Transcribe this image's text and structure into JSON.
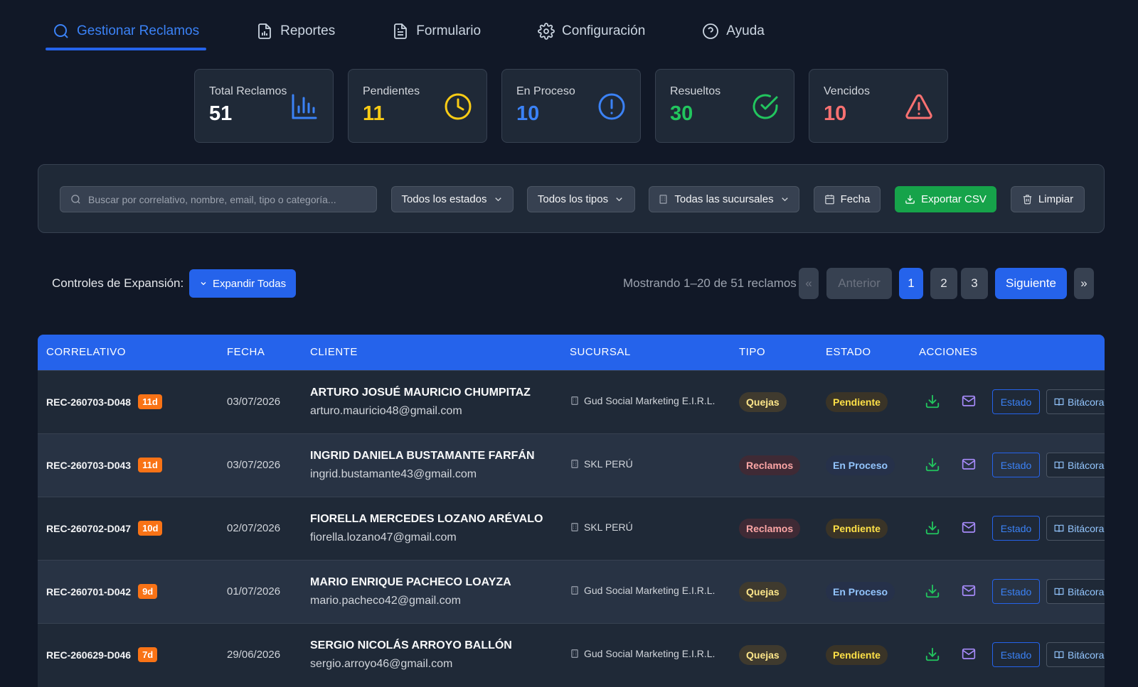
{
  "tabs": [
    {
      "label": "Gestionar Reclamos",
      "icon": "search-icon"
    },
    {
      "label": "Reportes",
      "icon": "report-icon"
    },
    {
      "label": "Formulario",
      "icon": "document-icon"
    },
    {
      "label": "Configuración",
      "icon": "gear-icon"
    },
    {
      "label": "Ayuda",
      "icon": "help-icon"
    }
  ],
  "stats": [
    {
      "label": "Total Reclamos",
      "value": "51",
      "color": "#ffffff",
      "icon_color": "#3b82f6",
      "icon": "bar-chart-icon"
    },
    {
      "label": "Pendientes",
      "value": "11",
      "color": "#facc15",
      "icon_color": "#facc15",
      "icon": "clock-icon"
    },
    {
      "label": "En Proceso",
      "value": "10",
      "color": "#3b82f6",
      "icon_color": "#3b82f6",
      "icon": "alert-circle-icon"
    },
    {
      "label": "Resueltos",
      "value": "30",
      "color": "#22c55e",
      "icon_color": "#22c55e",
      "icon": "check-circle-icon"
    },
    {
      "label": "Vencidos",
      "value": "10",
      "color": "#f87171",
      "icon_color": "#f87171",
      "icon": "warning-icon"
    }
  ],
  "filters": {
    "search_placeholder": "Buscar por correlativo, nombre, email, tipo o categoría...",
    "status": "Todos los estados",
    "type": "Todos los tipos",
    "branch": "Todas las sucursales",
    "date": "Fecha",
    "export": "Exportar CSV",
    "clear": "Limpiar"
  },
  "controls": {
    "label": "Controles de Expansión:",
    "expand": "Expandir Todas"
  },
  "pagination": {
    "showing": "Mostrando 1–20 de 51 reclamos",
    "first": "«",
    "prev": "Anterior",
    "pages": [
      "1",
      "2",
      "3"
    ],
    "current": "1",
    "next": "Siguiente",
    "last": "»"
  },
  "table": {
    "headers": [
      "CORRELATIVO",
      "FECHA",
      "CLIENTE",
      "SUCURSAL",
      "TIPO",
      "ESTADO",
      "ACCIONES"
    ],
    "estado_btn": "Estado",
    "bitacora_btn": "Bitácora",
    "rows": [
      {
        "id": "REC-260703-D048",
        "days": "11d",
        "date": "03/07/2026",
        "name": "ARTURO JOSUÉ MAURICIO CHUMPITAZ",
        "email": "arturo.mauricio48@gmail.com",
        "branch": "Gud Social Marketing E.I.R.L.",
        "type": "Quejas",
        "status": "Pendiente"
      },
      {
        "id": "REC-260703-D043",
        "days": "11d",
        "date": "03/07/2026",
        "name": "INGRID DANIELA BUSTAMANTE FARFÁN",
        "email": "ingrid.bustamante43@gmail.com",
        "branch": "SKL PERÚ",
        "type": "Reclamos",
        "status": "En Proceso"
      },
      {
        "id": "REC-260702-D047",
        "days": "10d",
        "date": "02/07/2026",
        "name": "FIORELLA MERCEDES LOZANO ARÉVALO",
        "email": "fiorella.lozano47@gmail.com",
        "branch": "SKL PERÚ",
        "type": "Reclamos",
        "status": "Pendiente"
      },
      {
        "id": "REC-260701-D042",
        "days": "9d",
        "date": "01/07/2026",
        "name": "MARIO ENRIQUE PACHECO LOAYZA",
        "email": "mario.pacheco42@gmail.com",
        "branch": "Gud Social Marketing E.I.R.L.",
        "type": "Quejas",
        "status": "En Proceso"
      },
      {
        "id": "REC-260629-D046",
        "days": "7d",
        "date": "29/06/2026",
        "name": "SERGIO NICOLÁS ARROYO BALLÓN",
        "email": "sergio.arroyo46@gmail.com",
        "branch": "Gud Social Marketing E.I.R.L.",
        "type": "Quejas",
        "status": "Pendiente"
      }
    ]
  }
}
